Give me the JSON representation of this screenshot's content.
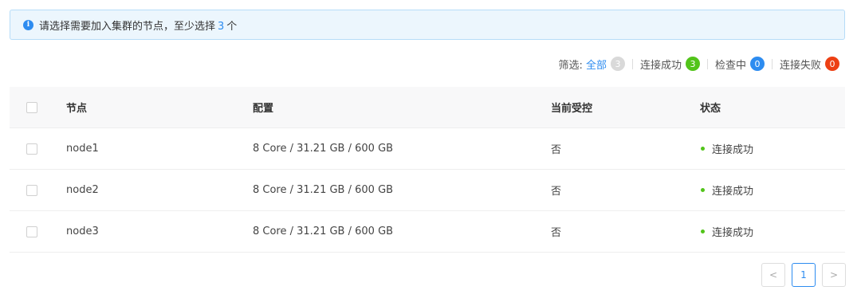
{
  "alert": {
    "prefix": "请选择需要加入集群的节点，至少选择",
    "count": "3",
    "suffix": "个",
    "icon": "info-icon"
  },
  "filter": {
    "label": "筛选:",
    "items": [
      {
        "label": "全部",
        "count": "3",
        "color": "#d9d9d9"
      },
      {
        "label": "连接成功",
        "count": "3",
        "color": "#52c41a"
      },
      {
        "label": "检查中",
        "count": "0",
        "color": "#2d8cf0"
      },
      {
        "label": "连接失败",
        "count": "0",
        "color": "#ed4014"
      }
    ]
  },
  "table": {
    "columns": [
      "节点",
      "配置",
      "当前受控",
      "状态"
    ],
    "rows": [
      {
        "node": "node1",
        "config": "8 Core / 31.21 GB / 600 GB",
        "controlled": "否",
        "status": "连接成功"
      },
      {
        "node": "node2",
        "config": "8 Core / 31.21 GB / 600 GB",
        "controlled": "否",
        "status": "连接成功"
      },
      {
        "node": "node3",
        "config": "8 Core / 31.21 GB / 600 GB",
        "controlled": "否",
        "status": "连接成功"
      }
    ]
  },
  "pagination": {
    "prev": "<",
    "current": "1",
    "next": ">"
  },
  "colors": {
    "accent": "#2d8cf0",
    "success": "#52c41a",
    "danger": "#ed4014"
  }
}
